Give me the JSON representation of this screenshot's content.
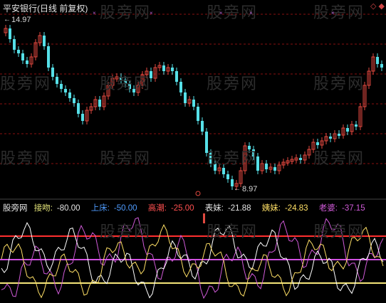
{
  "title": "平安银行(日线 前复权)",
  "high_label": "14.97",
  "low_label": "8.97",
  "arrow_high": "←",
  "arrow_low": "←",
  "watermark": "股旁网",
  "corner_icons": "◇ ◆",
  "xmarks": [
    "×",
    "×",
    "×",
    "×",
    "×"
  ],
  "indicator": {
    "name": "股旁网",
    "items": [
      {
        "label": "接吻:",
        "value": "-80.00",
        "color": "#e6e67a"
      },
      {
        "label": "上床:",
        "value": "-50.00",
        "color": "#4f9cff"
      },
      {
        "label": "高潮:",
        "value": "-25.00",
        "color": "#ff5050"
      },
      {
        "label": "表妹:",
        "value": "-21.88",
        "color": "#e6e6e6"
      },
      {
        "label": "姨妹:",
        "value": "-24.83",
        "color": "#ffe066"
      },
      {
        "label": "老婆:",
        "value": "-37.15",
        "color": "#d05ad8"
      }
    ]
  },
  "colors": {
    "up": "#e0493f",
    "down": "#56e0e8",
    "grid": "#8a1010",
    "red_line": "#ff3030",
    "magenta_line": "#d050e0",
    "yellow_line": "#f5e67a"
  }
}
